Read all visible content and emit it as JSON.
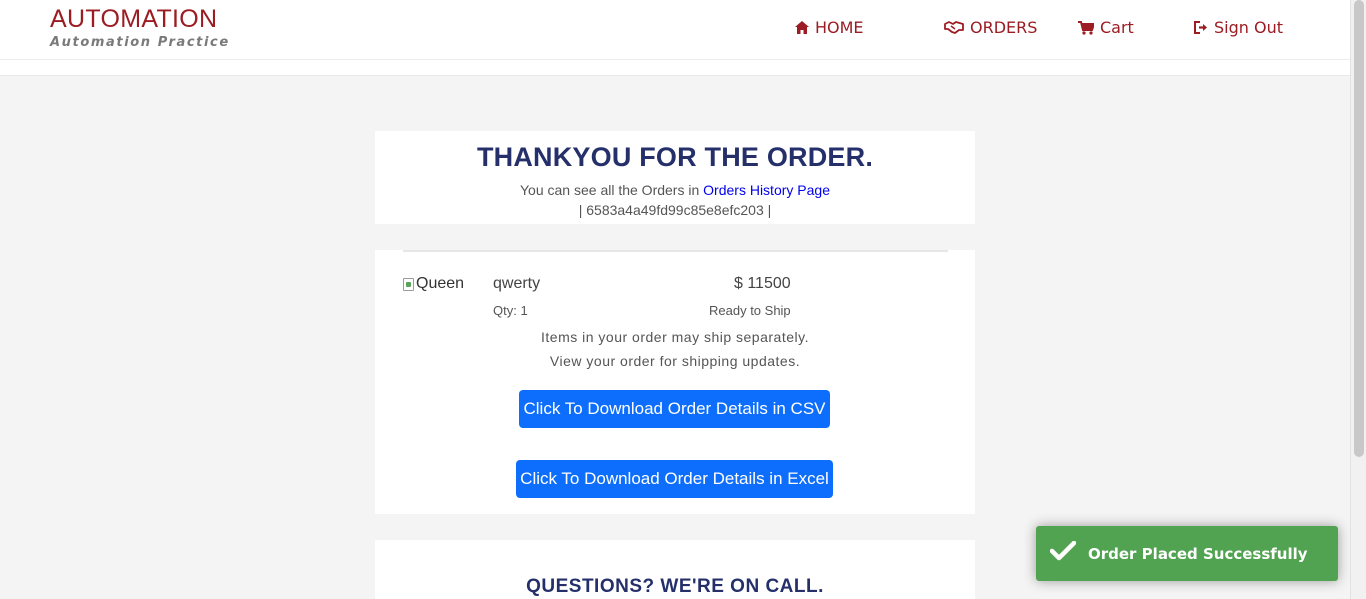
{
  "brand": {
    "title": "AUTOMATION",
    "subtitle": "Automation Practice"
  },
  "nav": {
    "home": {
      "label": "HOME",
      "icon": "home-icon"
    },
    "orders": {
      "label": "ORDERS",
      "icon": "handshake-icon"
    },
    "cart": {
      "label": "Cart",
      "icon": "cart-icon"
    },
    "signout": {
      "label": "Sign Out",
      "icon": "sign-out-icon"
    }
  },
  "thanks": {
    "title": "THANKYOU FOR THE ORDER.",
    "text": "You can see all the Orders in",
    "link": "Orders History Page",
    "order_id_line": "| 6583a4a49fd99c85e8efc203 |"
  },
  "order": {
    "image_alt": "Queen",
    "product_name": "qwerty",
    "price": "$ 11500",
    "qty": "Qty: 1",
    "status": "Ready to Ship",
    "ship_note_1": "Items in your order may ship separately.",
    "ship_note_2": "View your order for shipping updates.",
    "csv_button": "Click To Download Order Details in CSV",
    "excel_button": "Click To Download Order Details in Excel"
  },
  "questions": {
    "title": "QUESTIONS? WE'RE ON CALL."
  },
  "toast": {
    "message": "Order Placed Successfully"
  },
  "colors": {
    "brand_red": "#9b1c22",
    "heading_navy": "#25306b",
    "button_blue": "#0d6efd",
    "toast_green": "#51a351",
    "link_blue": "#0000ee"
  }
}
